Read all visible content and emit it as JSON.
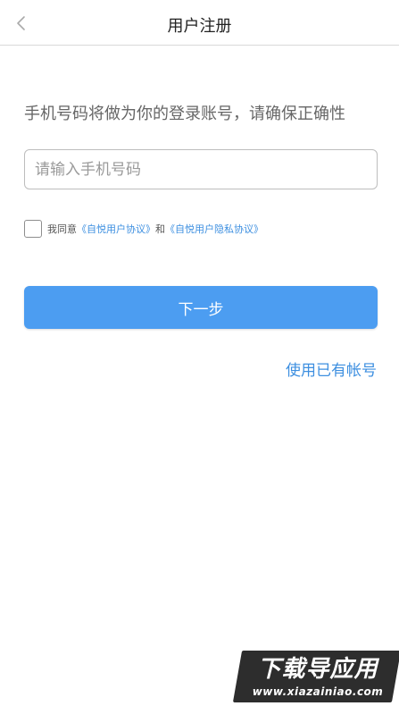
{
  "header": {
    "title": "用户注册",
    "back_icon": "chevron-left-icon"
  },
  "form": {
    "hint": "手机号码将做为你的登录账号，请确保正确性",
    "phone_placeholder": "请输入手机号码",
    "phone_value": ""
  },
  "agreement": {
    "checked": false,
    "prefix": "我同意",
    "link1": "《自悦用户协议》",
    "joiner": "和",
    "link2": "《自悦用户隐私协议》"
  },
  "actions": {
    "next_label": "下一步",
    "existing_account_label": "使用已有帐号"
  },
  "watermark": {
    "title": "下载导应用",
    "url": "www.xiazainiao.com"
  },
  "colors": {
    "primary": "#4c9df1",
    "link": "#3d8fe0",
    "text": "#666666"
  }
}
